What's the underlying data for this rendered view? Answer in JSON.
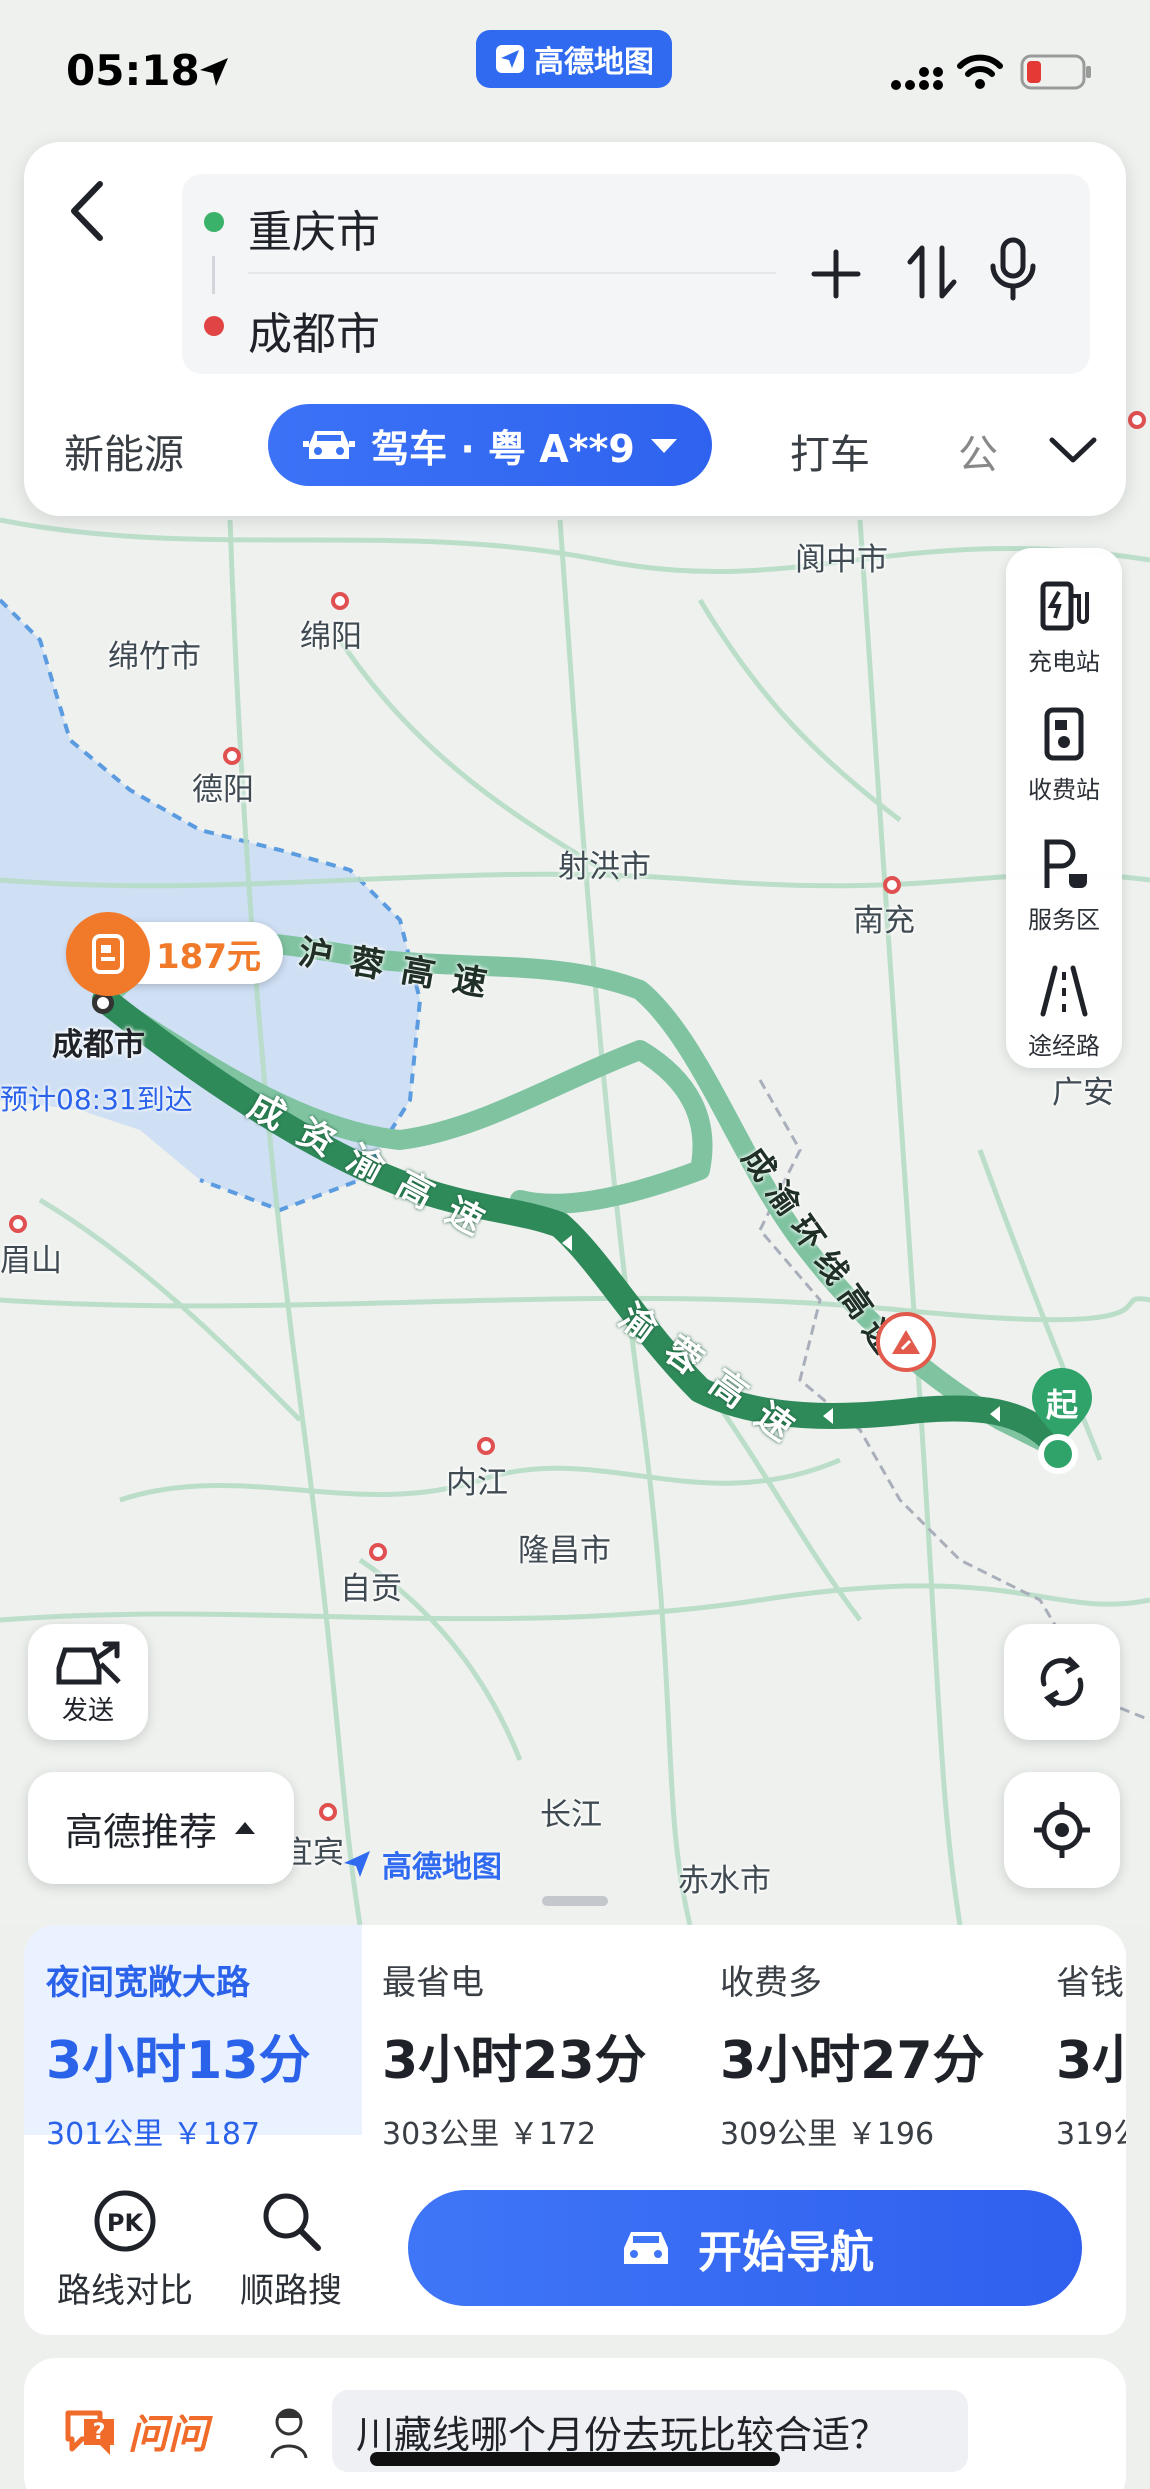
{
  "status": {
    "time": "05:18",
    "app_badge": "高德地图"
  },
  "search": {
    "origin": "重庆市",
    "destination": "成都市"
  },
  "modes": {
    "left": "新能源",
    "active": "驾车 · 粤 A**9",
    "tab_taxi": "打车",
    "tab_transit_partial": "公"
  },
  "tools": {
    "charging": "充电站",
    "toll": "收费站",
    "service": "服务区",
    "via": "途经路"
  },
  "map": {
    "places": [
      "阆中市",
      "绵竹市",
      "绵阳",
      "德阳",
      "射洪市",
      "南充",
      "广安",
      "眉山",
      "内江",
      "隆昌市",
      "自贡",
      "长江",
      "宜宾",
      "赤水市",
      "成都市"
    ],
    "highways": {
      "huron": "沪蓉高速",
      "chengziyu": "成资渝高速",
      "yurong": "渝蓉高速",
      "chengyuhuan": "成渝环线高速"
    },
    "toll_badge": "187元",
    "eta_label": "预计08:31到达",
    "start_marker": "起",
    "watermark": "高德地图",
    "send_label": "发送",
    "recommend_label": "高德推荐"
  },
  "routes": [
    {
      "tag": "夜间宽敞大路",
      "time": "3小时13分",
      "meta": "301公里 ￥187"
    },
    {
      "tag": "最省电",
      "time": "3小时23分",
      "meta": "303公里 ￥172"
    },
    {
      "tag": "收费多",
      "time": "3小时27分",
      "meta": "309公里 ￥196"
    },
    {
      "tag": "省钱",
      "time": "3小",
      "meta": "319公"
    }
  ],
  "actions": {
    "compare": "路线对比",
    "along_search": "顺路搜",
    "start_nav": "开始导航"
  },
  "ask": {
    "label": "问问",
    "question": "川藏线哪个月份去玩比较合适？"
  },
  "colors": {
    "accent": "#2f6af0",
    "route_main": "#2f8a5a",
    "route_alt": "#7fc3a1",
    "toll_orange": "#f07a2a"
  }
}
